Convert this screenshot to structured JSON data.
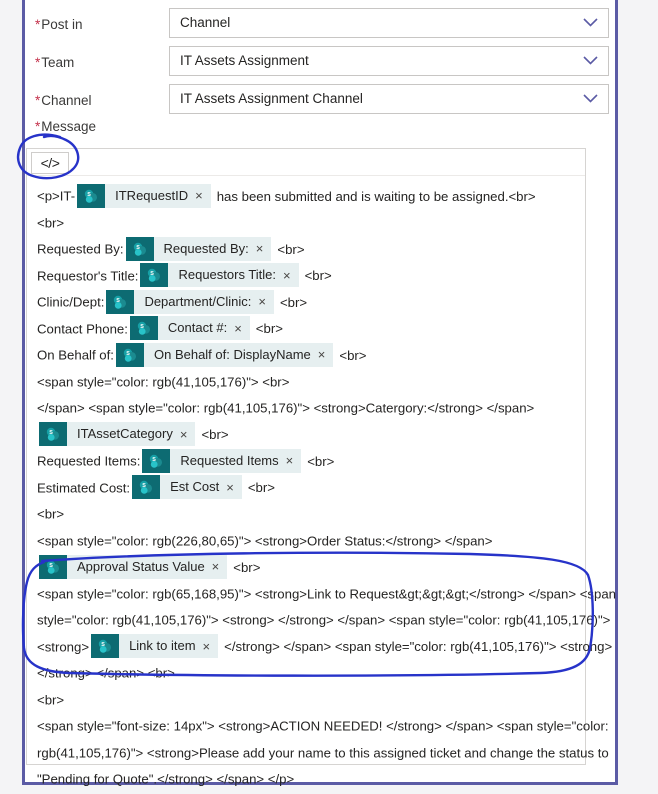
{
  "form": {
    "fields": [
      {
        "label": "Post in",
        "required_mark": "*",
        "value": "Channel",
        "icon": "chevron-down-icon"
      },
      {
        "label": "Team",
        "required_mark": "*",
        "value": "IT Assets Assignment",
        "icon": "chevron-down-icon"
      },
      {
        "label": "Channel",
        "required_mark": "*",
        "value": "IT Assets Assignment Channel",
        "icon": "chevron-down-icon"
      }
    ],
    "message_field": {
      "label": "Message",
      "required_mark": "*",
      "toolbar": {
        "code_view_label": "</>",
        "icon": "code-icon"
      }
    }
  },
  "message_body": {
    "lines": [
      {
        "segments": [
          {
            "type": "text",
            "value": "<p>IT-"
          },
          {
            "type": "chip",
            "value": "ITRequestID"
          },
          {
            "type": "text",
            "value": "has been submitted and is waiting to be assigned.<br>"
          }
        ]
      },
      {
        "segments": [
          {
            "type": "text",
            "value": "<br>"
          }
        ]
      },
      {
        "segments": [
          {
            "type": "text",
            "value": "Requested By:"
          },
          {
            "type": "chip",
            "value": "Requested By:"
          },
          {
            "type": "text",
            "value": "<br>"
          }
        ]
      },
      {
        "segments": [
          {
            "type": "text",
            "value": "Requestor's Title:"
          },
          {
            "type": "chip",
            "value": "Requestors Title:"
          },
          {
            "type": "text",
            "value": "<br>"
          }
        ]
      },
      {
        "segments": [
          {
            "type": "text",
            "value": "Clinic/Dept:"
          },
          {
            "type": "chip",
            "value": "Department/Clinic:"
          },
          {
            "type": "text",
            "value": "<br>"
          }
        ]
      },
      {
        "segments": [
          {
            "type": "text",
            "value": "Contact Phone:"
          },
          {
            "type": "chip",
            "value": "Contact #:"
          },
          {
            "type": "text",
            "value": "<br>"
          }
        ]
      },
      {
        "segments": [
          {
            "type": "text",
            "value": "On Behalf of:"
          },
          {
            "type": "chip",
            "value": "On Behalf of: DisplayName"
          },
          {
            "type": "text",
            "value": "<br>"
          }
        ]
      },
      {
        "segments": [
          {
            "type": "text",
            "value": "<span style=\"color: rgb(41,105,176)\"> <br>"
          }
        ]
      },
      {
        "segments": [
          {
            "type": "text",
            "value": "</span> <span style=\"color: rgb(41,105,176)\"> <strong>Catergory:</strong> </span>"
          }
        ]
      },
      {
        "segments": [
          {
            "type": "chip",
            "value": "ITAssetCategory"
          },
          {
            "type": "text",
            "value": "<br>"
          }
        ]
      },
      {
        "segments": [
          {
            "type": "text",
            "value": "Requested Items:"
          },
          {
            "type": "chip",
            "value": "Requested Items"
          },
          {
            "type": "text",
            "value": "<br>"
          }
        ]
      },
      {
        "segments": [
          {
            "type": "text",
            "value": "Estimated Cost:"
          },
          {
            "type": "chip",
            "value": "Est Cost"
          },
          {
            "type": "text",
            "value": "<br>"
          }
        ]
      },
      {
        "segments": [
          {
            "type": "text",
            "value": "<br>"
          }
        ]
      },
      {
        "segments": [
          {
            "type": "text",
            "value": "<span style=\"color: rgb(226,80,65)\"> <strong>Order Status:</strong> </span>"
          }
        ]
      },
      {
        "segments": [
          {
            "type": "chip",
            "value": "Approval Status Value"
          },
          {
            "type": "text",
            "value": "<br>"
          }
        ]
      }
    ],
    "highlighted_block": {
      "line_a": "<span style=\"color: rgb(65,168,95)\"> <strong>Link to Request&gt;&gt;&gt;</strong> </span> <span",
      "line_b": "style=\"color: rgb(41,105,176)\"> <strong> </strong> </span> <span style=\"color: rgb(41,105,176)\">",
      "line_c_pre": "<strong>",
      "line_c_chip": "Link to item",
      "line_c_post": "</strong> </span> <span style=\"color: rgb(41,105,176)\"> <strong>",
      "line_d": "</strong> </span> <br>"
    },
    "footer_lines": [
      "<br>",
      "<span style=\"font-size: 14px\"> <strong>ACTION NEEDED! </strong> </span> <span style=\"color:",
      "rgb(41,105,176)\"> <strong>Please add your name to this assigned ticket and change the status to",
      "\"Pending for Quote\".</strong> </span> </p>"
    ]
  },
  "annotations": [
    {
      "name": "ellipse-around-code-button",
      "shape": "hand-drawn-ellipse",
      "color": "#2733c9"
    },
    {
      "name": "ellipse-around-link-block",
      "shape": "hand-drawn-rounded-rect",
      "color": "#2733c9"
    }
  ],
  "colors": {
    "card_border": "#5b5ba5",
    "required_asterisk": "#c4314b",
    "chevron": "#5b5ba5",
    "chip_background": "#e6eff0",
    "chip_icon_background": "#0d6b72",
    "annotation": "#2733c9",
    "page_background": "#f4f4f6"
  }
}
